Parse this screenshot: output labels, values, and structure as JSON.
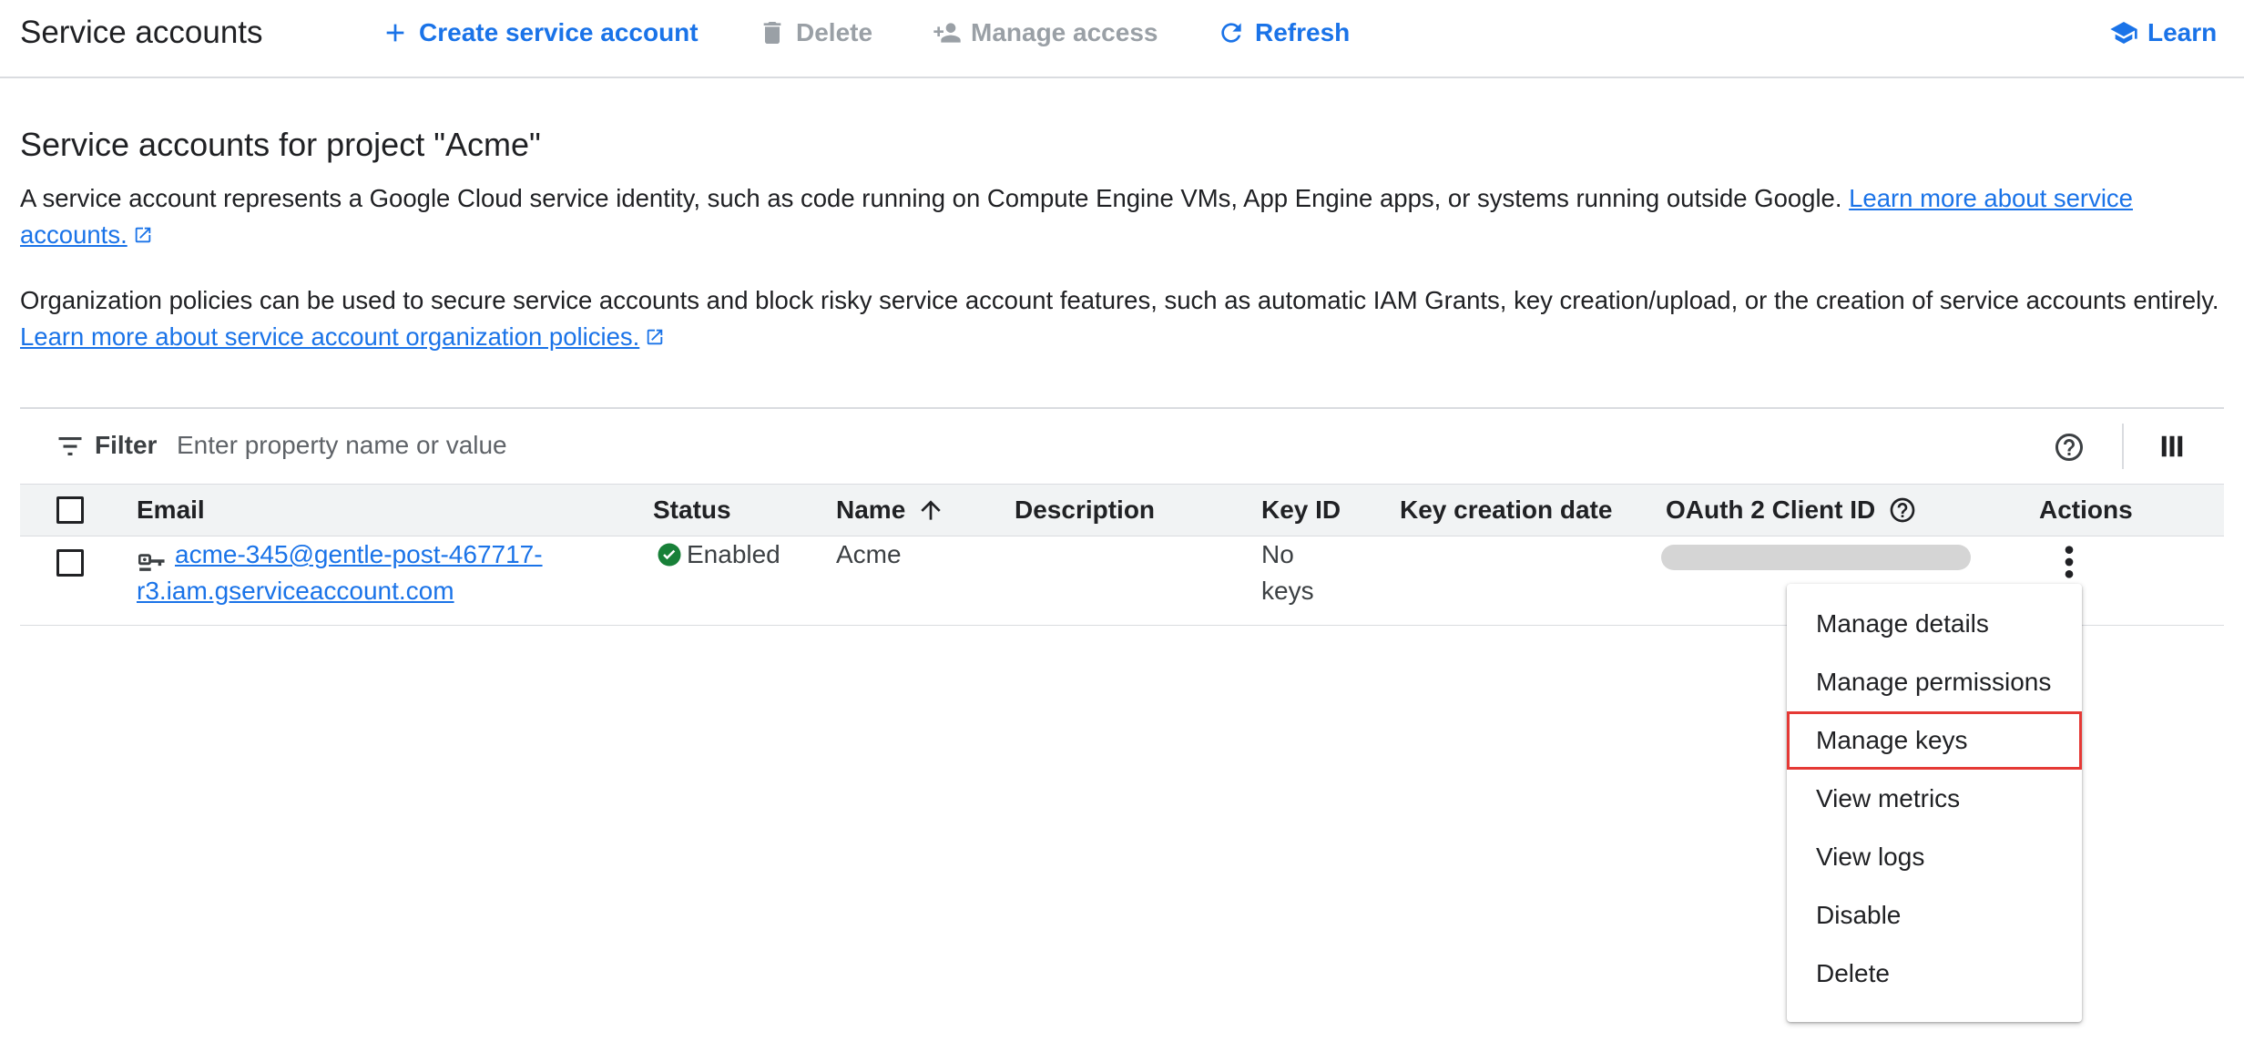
{
  "toolbar": {
    "title": "Service accounts",
    "create_label": "Create service account",
    "delete_label": "Delete",
    "manage_access_label": "Manage access",
    "refresh_label": "Refresh",
    "learn_label": "Learn"
  },
  "main": {
    "heading": "Service accounts for project \"Acme\"",
    "description_text": "A service account represents a Google Cloud service identity, such as code running on Compute Engine VMs, App Engine apps, or systems running outside Google. ",
    "description_link": "Learn more about service accounts.",
    "policy_text": "Organization policies can be used to secure service accounts and block risky service account features, such as automatic IAM Grants, key creation/upload, or the creation of service accounts entirely. ",
    "policy_link": "Learn more about service account organization policies."
  },
  "filter": {
    "label": "Filter",
    "placeholder": "Enter property name or value"
  },
  "table": {
    "columns": {
      "email": "Email",
      "status": "Status",
      "name": "Name",
      "description": "Description",
      "key_id": "Key ID",
      "key_creation_date": "Key creation date",
      "oauth_client_id": "OAuth 2 Client ID",
      "actions": "Actions"
    },
    "rows": [
      {
        "email_line1": "acme-345@gentle-post-467717-",
        "email_line2": "r3.iam.gserviceaccount.com",
        "status": "Enabled",
        "name": "Acme",
        "description": "",
        "key_id_line1": "No",
        "key_id_line2": "keys",
        "key_creation_date": ""
      }
    ]
  },
  "actions_menu": {
    "items": [
      "Manage details",
      "Manage permissions",
      "Manage keys",
      "View metrics",
      "View logs",
      "Disable",
      "Delete"
    ],
    "highlighted": "Manage keys"
  },
  "colors": {
    "accent": "#1a73e8",
    "status_enabled": "#188038",
    "highlight": "#e53935"
  },
  "icons": {
    "create": "plus-icon",
    "delete": "trash-icon",
    "manage_access": "person-add-icon",
    "refresh": "refresh-icon",
    "learn": "school-icon",
    "filter": "filter-list-icon",
    "help": "help-circle-icon",
    "columns": "column-display-icon",
    "service_account": "service-account-icon",
    "status_ok": "check-circle-icon",
    "sort": "arrow-up-icon",
    "external": "open-in-new-icon",
    "actions": "more-vert-icon"
  }
}
